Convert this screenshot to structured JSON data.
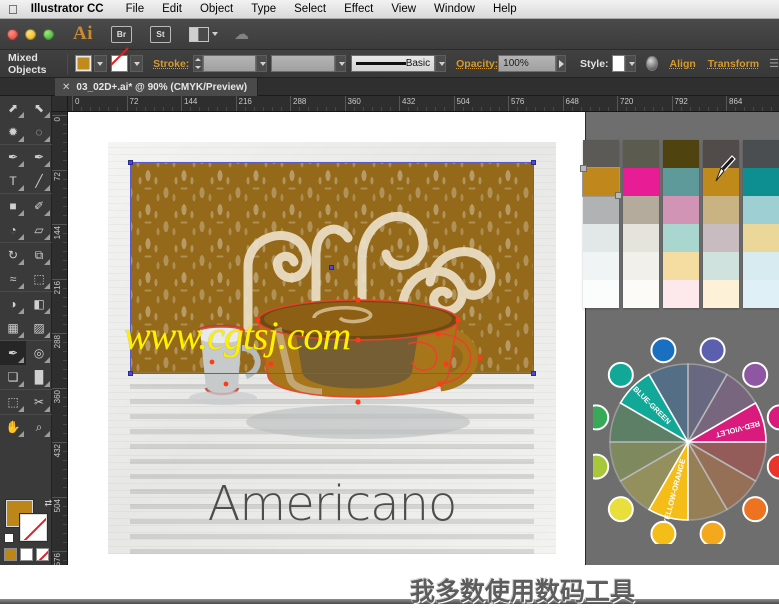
{
  "menubar": {
    "apple_icon": "apple-icon",
    "items": [
      {
        "label": "Illustrator CC",
        "bold": true
      },
      {
        "label": "File"
      },
      {
        "label": "Edit"
      },
      {
        "label": "Object"
      },
      {
        "label": "Type"
      },
      {
        "label": "Select"
      },
      {
        "label": "Effect"
      },
      {
        "label": "View"
      },
      {
        "label": "Window"
      },
      {
        "label": "Help"
      }
    ]
  },
  "appbar": {
    "logo": "Ai",
    "bridge_label": "Br",
    "stock_label": "St",
    "arrange_icon": "arrange-documents-icon",
    "cloud_icon": "creative-cloud-icon"
  },
  "controlbar": {
    "selection_label": "Mixed Objects",
    "fill_label": "fill-swatch",
    "stroke_swatch_label": "stroke-swatch",
    "stroke_label": "Stroke:",
    "stroke_weight": "",
    "stroke_profile": "",
    "brush_label": "Basic",
    "opacity_label": "Opacity:",
    "opacity_value": "100%",
    "style_label": "Style:",
    "align_label": "Align",
    "transform_label": "Transform",
    "colors": {
      "fill": "#c08a1d",
      "accent": "#d79a2b"
    }
  },
  "document": {
    "tab_title": "03_02D+.ai* @ 90% (CMYK/Preview)",
    "close_icon": "close-icon",
    "zoom": "90%",
    "color_mode": "CMYK/Preview"
  },
  "rulers": {
    "horizontal_ticks": [
      "0",
      "72",
      "144",
      "216",
      "288",
      "360",
      "432",
      "504",
      "576",
      "648",
      "720",
      "792",
      "864"
    ],
    "vertical_ticks": [
      "0",
      "72",
      "144",
      "216",
      "288",
      "360",
      "432",
      "504",
      "576"
    ],
    "unit_spacing_px": 72
  },
  "toolpalette": {
    "tools": [
      {
        "name": "selection-tool",
        "glyph": "⬈"
      },
      {
        "name": "direct-selection-tool",
        "glyph": "⬉"
      },
      {
        "name": "magic-wand-tool",
        "glyph": "✹"
      },
      {
        "name": "lasso-tool",
        "glyph": "◌"
      },
      {
        "name": "pen-tool",
        "glyph": "✒"
      },
      {
        "name": "add-anchor-point-tool",
        "glyph": "✒"
      },
      {
        "name": "type-tool",
        "glyph": "T"
      },
      {
        "name": "line-segment-tool",
        "glyph": "╱"
      },
      {
        "name": "rectangle-tool",
        "glyph": "■"
      },
      {
        "name": "paintbrush-tool",
        "glyph": "✐"
      },
      {
        "name": "shaper-tool",
        "glyph": "◔"
      },
      {
        "name": "eraser-tool",
        "glyph": "▱"
      },
      {
        "name": "rotate-tool",
        "glyph": "↻"
      },
      {
        "name": "scale-tool",
        "glyph": "⧉"
      },
      {
        "name": "width-tool",
        "glyph": "≈"
      },
      {
        "name": "free-transform-tool",
        "glyph": "⬚"
      },
      {
        "name": "shape-builder-tool",
        "glyph": "◑"
      },
      {
        "name": "perspective-grid-tool",
        "glyph": "◧"
      },
      {
        "name": "mesh-tool",
        "glyph": "▦"
      },
      {
        "name": "gradient-tool",
        "glyph": "▨"
      },
      {
        "name": "eyedropper-tool",
        "glyph": "✒",
        "selected": true
      },
      {
        "name": "blend-tool",
        "glyph": "◎"
      },
      {
        "name": "symbol-sprayer-tool",
        "glyph": "❑"
      },
      {
        "name": "column-graph-tool",
        "glyph": "█"
      },
      {
        "name": "artboard-tool",
        "glyph": "⬚"
      },
      {
        "name": "slice-tool",
        "glyph": "✂"
      },
      {
        "name": "hand-tool",
        "glyph": "✋"
      },
      {
        "name": "zoom-tool",
        "glyph": "⌕"
      }
    ],
    "fill_color": "#bd8618",
    "stroke_color": "none",
    "swap-icon": "⇄"
  },
  "artwork": {
    "title_text": "Americano",
    "watermark_text": "www.cgtsj.com",
    "band_color": "#94691a",
    "cup_color": "#b07c18",
    "watermark_color": "#fff000",
    "title_color": "#4d4d4d"
  },
  "swatch_panel": {
    "columns": [
      {
        "name": "palette-column-1",
        "cells": [
          "#5b5a56",
          "#c0881c",
          "#b0b2b3",
          "#e2e8e8",
          "#f0f4f4",
          "#fbfdfd"
        ],
        "selected_index": 1
      },
      {
        "name": "palette-column-2",
        "cells": [
          "#5c5b50",
          "#e81d96",
          "#b4ab9c",
          "#e4e4dc",
          "#f2f0ea",
          "#fcfbf8"
        ]
      },
      {
        "name": "palette-column-3",
        "cells": [
          "#4f4410",
          "#5f9a9a",
          "#d294b5",
          "#a9d6cf",
          "#f5dca0",
          "#fde8ec"
        ]
      },
      {
        "name": "palette-column-4",
        "cells": [
          "#514c4a",
          "#c08a1b",
          "#c9b382",
          "#c9bcc0",
          "#cfe2de",
          "#fdf1d8"
        ]
      },
      {
        "name": "palette-column-5",
        "cells": [
          "#4a4e50",
          "#0d8f92",
          "#9ecfd2",
          "#ecd79a",
          "#d8ebf0",
          "#dff1f6"
        ]
      }
    ],
    "cursor_icon": "eyedropper-cursor-icon"
  },
  "color_wheel": {
    "labels": [
      "RED-VIOLET",
      "YELLOW-ORANGE",
      "BLUE-GREEN"
    ],
    "segments": [
      {
        "name": "red",
        "hex": "#e8342a"
      },
      {
        "name": "red-orange",
        "hex": "#ee7321"
      },
      {
        "name": "orange",
        "hex": "#f4a81d"
      },
      {
        "name": "yellow-orange",
        "hex": "#f5bd17"
      },
      {
        "name": "yellow",
        "hex": "#e8df3c"
      },
      {
        "name": "yellow-green",
        "hex": "#a8c73a"
      },
      {
        "name": "green",
        "hex": "#37a957"
      },
      {
        "name": "blue-green",
        "hex": "#12a897"
      },
      {
        "name": "blue",
        "hex": "#1a6fc0"
      },
      {
        "name": "blue-violet",
        "hex": "#5c5fae"
      },
      {
        "name": "violet",
        "hex": "#8e56a3"
      },
      {
        "name": "red-violet",
        "hex": "#d81b7c"
      }
    ]
  },
  "caption": {
    "text": "我多数使用数码工具"
  }
}
